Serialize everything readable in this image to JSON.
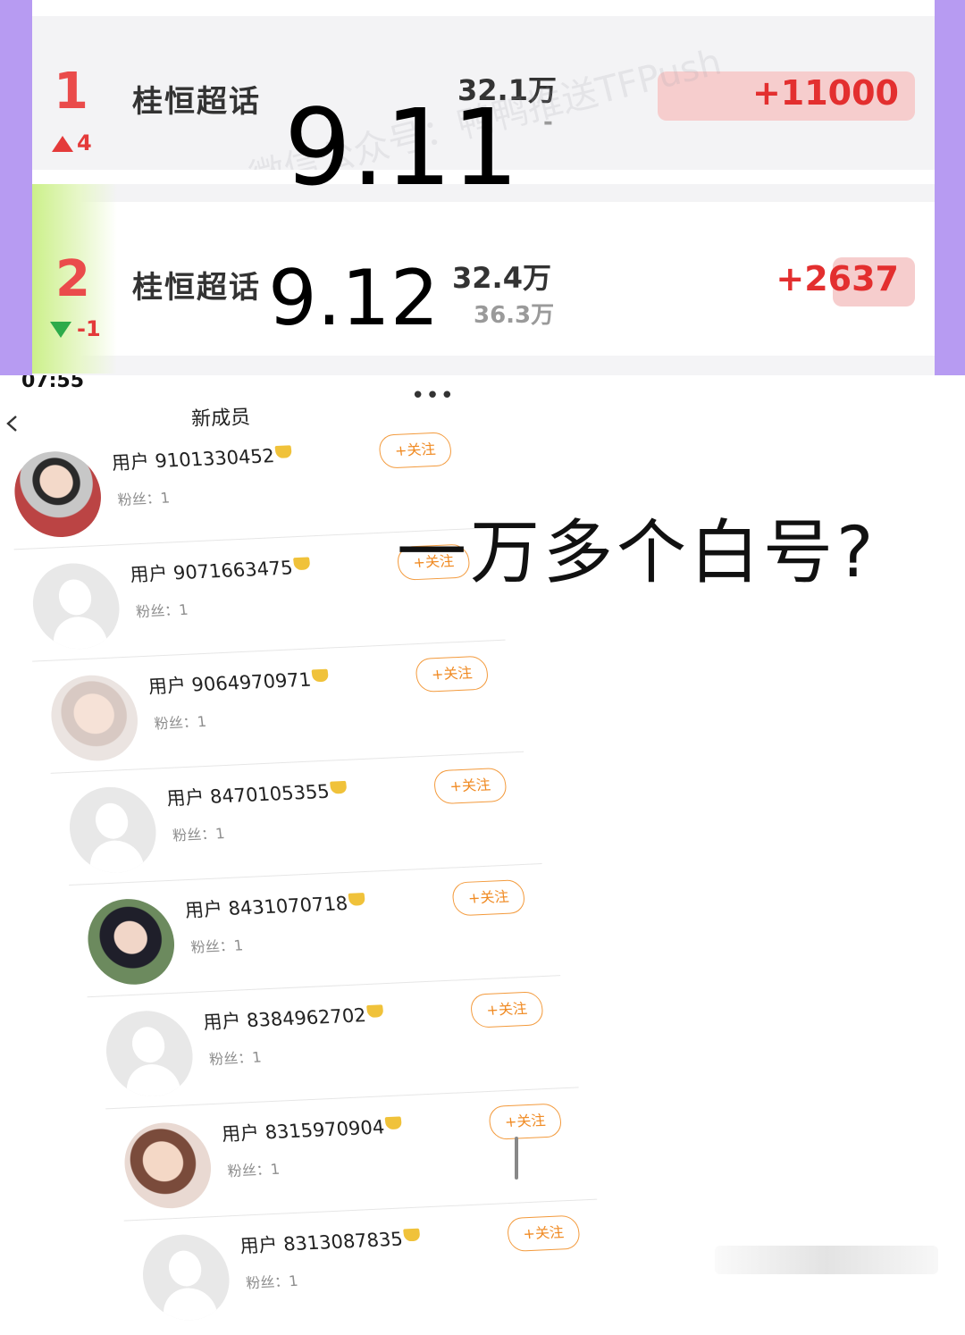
{
  "ranking": {
    "watermark": "微信公众号：鸭鸭推送TFPush",
    "rows": [
      {
        "rank": "1",
        "change": "4",
        "change_dir": "up",
        "name": "桂恒超话",
        "count": "32.1万",
        "count_sub": "-",
        "delta": "+11000",
        "date": "9.11"
      },
      {
        "rank": "2",
        "change": "-1",
        "change_dir": "down",
        "name": "桂恒超话",
        "count": "32.4万",
        "count_sub": "36.3万",
        "delta": "+2637",
        "date": "9.12"
      }
    ],
    "colors": {
      "rank": "#ea4b4b",
      "delta": "#e32f2f",
      "up": "#e43a3a",
      "down": "#2dab4a",
      "frame": "#b79bf2"
    }
  },
  "phone": {
    "status_time": "07:55",
    "title": "新成员",
    "more_icon": "ellipsis-icon",
    "back_icon": "chevron-left-icon",
    "follow_label": "+关注",
    "fans_label": "粉丝：1",
    "members": [
      {
        "name": "用户 9101330452",
        "avatar": "photo"
      },
      {
        "name": "用户 9071663475",
        "avatar": "default"
      },
      {
        "name": "用户 9064970971",
        "avatar": "photo"
      },
      {
        "name": "用户 8470105355",
        "avatar": "default"
      },
      {
        "name": "用户 8431070718",
        "avatar": "photo"
      },
      {
        "name": "用户 8384962702",
        "avatar": "default"
      },
      {
        "name": "用户 8315970904",
        "avatar": "photo"
      },
      {
        "name": "用户 8313087835",
        "avatar": "default"
      }
    ]
  },
  "caption": "一万多个白号?"
}
